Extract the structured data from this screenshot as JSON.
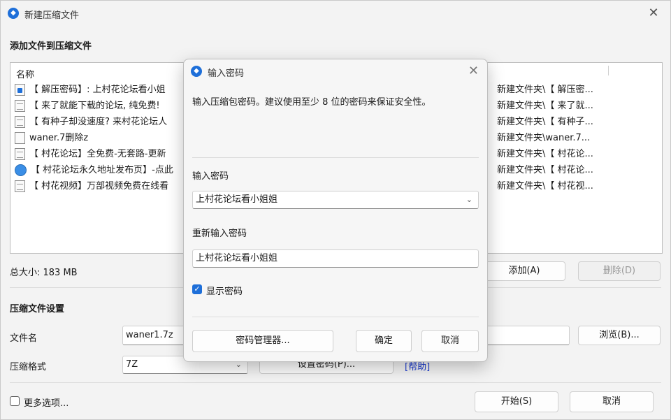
{
  "window": {
    "title": "新建压缩文件",
    "add_section": "添加文件到压缩文件"
  },
  "filelist": {
    "header_name": "名称",
    "rows": [
      {
        "name": "【 解压密码】: 上村花论坛看小姐",
        "path": "新建文件夹\\【 解压密...",
        "icon": "special-file-icon"
      },
      {
        "name": "【 来了就能下载的论坛, 纯免费!",
        "path": "新建文件夹\\【 来了就...",
        "icon": "text-file-icon"
      },
      {
        "name": "【 有种子却没速度? 来村花论坛人",
        "path": "新建文件夹\\【 有种子...",
        "icon": "text-file-icon"
      },
      {
        "name": "waner.7删除z",
        "path": "新建文件夹\\waner.7...",
        "icon": "blank-file-icon"
      },
      {
        "name": "【 村花论坛】全免费-无套路-更新",
        "path": "新建文件夹\\【 村花论...",
        "icon": "text-file-icon"
      },
      {
        "name": "【 村花论坛永久地址发布页】-点此",
        "path": "新建文件夹\\【 村花论...",
        "icon": "globe-icon"
      },
      {
        "name": "【 村花视频】万部视频免费在线看",
        "path": "新建文件夹\\【 村花视...",
        "icon": "text-file-icon"
      }
    ]
  },
  "total_size": "总大小: 183 MB",
  "buttons": {
    "add": "添加(A)",
    "delete": "删除(D)",
    "browse": "浏览(B)...",
    "set_password": "设置密码(P)...",
    "help": "[帮助]",
    "start": "开始(S)",
    "cancel": "取消"
  },
  "settings": {
    "section": "压缩文件设置",
    "filename_label": "文件名",
    "filename_value": "waner1.7z",
    "format_label": "压缩格式",
    "format_value": "7Z",
    "more_options": "更多选项..."
  },
  "dialog": {
    "title": "输入密码",
    "hint": "输入压缩包密码。建议使用至少 8 位的密码来保证安全性。",
    "password_label": "输入密码",
    "password_value": "上村花论坛看小姐姐",
    "reenter_label": "重新输入密码",
    "reenter_value": "上村花论坛看小姐姐",
    "show_password": "显示密码",
    "show_password_checked": true,
    "manager_button": "密码管理器...",
    "ok_button": "确定",
    "cancel_button": "取消"
  },
  "colors": {
    "accent": "#1e6fd9",
    "link": "#1a3ad0"
  }
}
